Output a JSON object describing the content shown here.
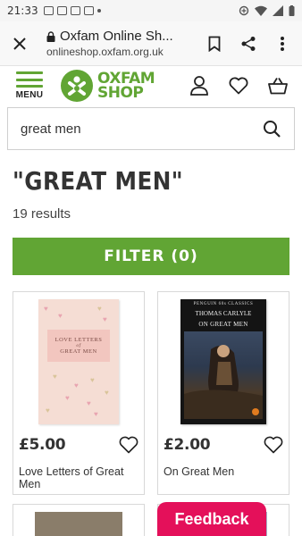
{
  "status_bar": {
    "time": "21:33"
  },
  "browser": {
    "page_title": "Oxfam Online Sh...",
    "url": "onlineshop.oxfam.org.uk"
  },
  "site_header": {
    "menu_label": "MENU",
    "logo_line1": "OXFAM",
    "logo_line2": "SHOP",
    "brand_color": "#61a534"
  },
  "search": {
    "value": "great men"
  },
  "results": {
    "title": "\"GREAT MEN\"",
    "count_text": "19 results"
  },
  "filter": {
    "label": "FILTER (0)"
  },
  "products": [
    {
      "price": "£5.00",
      "name": "Love Letters of Great Men",
      "cover_line1": "LOVE LETTERS",
      "cover_line2": "of",
      "cover_line3": "GREAT MEN"
    },
    {
      "price": "£2.00",
      "name": "On Great Men",
      "cover_series": "PENGUIN 60s CLASSICS",
      "cover_author": "THOMAS CARLYLE",
      "cover_title": "ON GREAT MEN"
    }
  ],
  "feedback": {
    "label": "Feedback",
    "color": "#e4105a"
  }
}
